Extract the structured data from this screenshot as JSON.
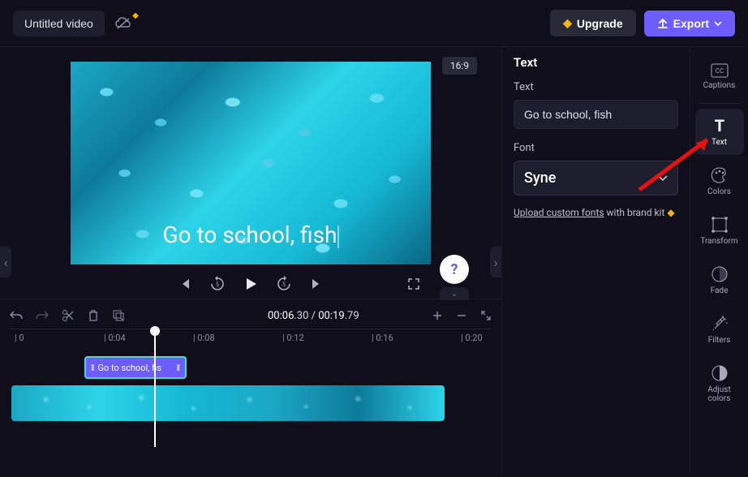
{
  "header": {
    "title": "Untitled video",
    "upgrade": "Upgrade",
    "export": "Export"
  },
  "preview": {
    "aspect": "16:9",
    "overlay_text": "Go to school, fish"
  },
  "timecode": {
    "current": "00:06",
    "current_frac": ".30",
    "sep": " / ",
    "total": "00:19",
    "total_frac": ".79"
  },
  "ruler": {
    "m0": "| 0",
    "m1": "| 0:04",
    "m2": "| 0:08",
    "m3": "| 0:12",
    "m4": "| 0:16",
    "m5": "| 0:20"
  },
  "clips": {
    "text_label": "Go to school, fis"
  },
  "panel": {
    "title": "Text",
    "text_label": "Text",
    "text_value": "Go to school, fish",
    "font_label": "Font",
    "font_value": "Syne",
    "upload_link": "Upload custom fonts",
    "upload_suffix": " with brand kit "
  },
  "rail": {
    "captions": "Captions",
    "text": "Text",
    "colors": "Colors",
    "transform": "Transform",
    "fade": "Fade",
    "filters": "Filters",
    "adjust": "Adjust\ncolors"
  }
}
